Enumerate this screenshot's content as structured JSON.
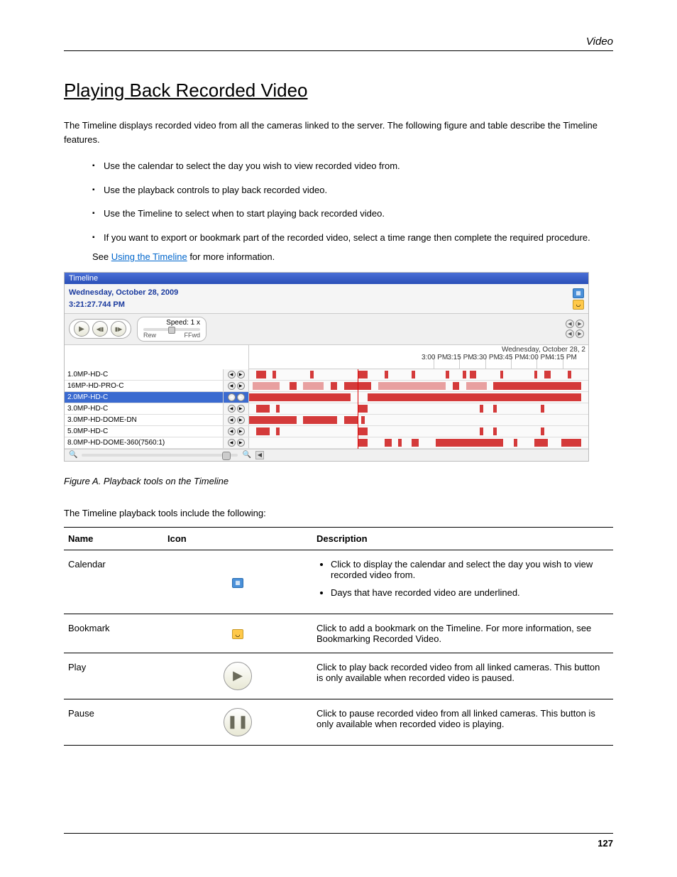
{
  "header": {
    "section": "Video"
  },
  "title": "Playing Back Recorded Video",
  "intro": "The Timeline displays recorded video from all the cameras linked to the server. The following figure and table describe the Timeline features.",
  "bullets": [
    "Use the calendar to select the day you wish to view recorded video from.",
    "Use the playback controls to play back recorded video.",
    "Use the Timeline to select when to start playing back recorded video.",
    "If you want to export or bookmark part of the recorded video, select a time range then complete the required procedure."
  ],
  "note_prefix": "See ",
  "note_link": "Using the Timeline",
  "note_suffix": " for more information.",
  "screenshot": {
    "title": "Timeline",
    "date_label": "Wednesday, October 28, 2009",
    "time_label": "3:21:27.744 PM",
    "speed_label": "Speed: 1 x",
    "rew_label": "Rew",
    "ffwd_label": "FFwd",
    "ruler_date": "Wednesday, October 28, 2",
    "ticks": [
      "3:00 PM",
      "3:15 PM",
      "3:30 PM",
      "3:45 PM",
      "4:00 PM",
      "4:15 PM"
    ],
    "cameras": [
      "1.0MP-HD-C",
      "16MP-HD-PRO-C",
      "2.0MP-HD-C",
      "3.0MP-HD-C",
      "3.0MP-HD-DOME-DN",
      "5.0MP-HD-C",
      "8.0MP-HD-DOME-360(7560:1)"
    ],
    "selected_index": 2
  },
  "figure_caption": "Figure A. Playback tools on the Timeline",
  "table_intro": "The Timeline playback tools include the following:",
  "table": {
    "headers": [
      "Name",
      "Icon",
      "Description"
    ],
    "rows": [
      {
        "name": "Calendar",
        "desc_bullets": [
          "Click to display the calendar and select the day you wish to view recorded video from.",
          "Days that have recorded video are underlined."
        ]
      },
      {
        "name": "Bookmark",
        "desc": "Click to add a bookmark on the Timeline. For more information, see Bookmarking Recorded Video."
      },
      {
        "name": "Play",
        "desc": "Click to play back recorded video from all linked cameras. This button is only available when recorded video is paused."
      },
      {
        "name": "Pause",
        "desc": "Click to pause recorded video from all linked cameras. This button is only available when recorded video is playing."
      }
    ]
  },
  "page_number": "127"
}
